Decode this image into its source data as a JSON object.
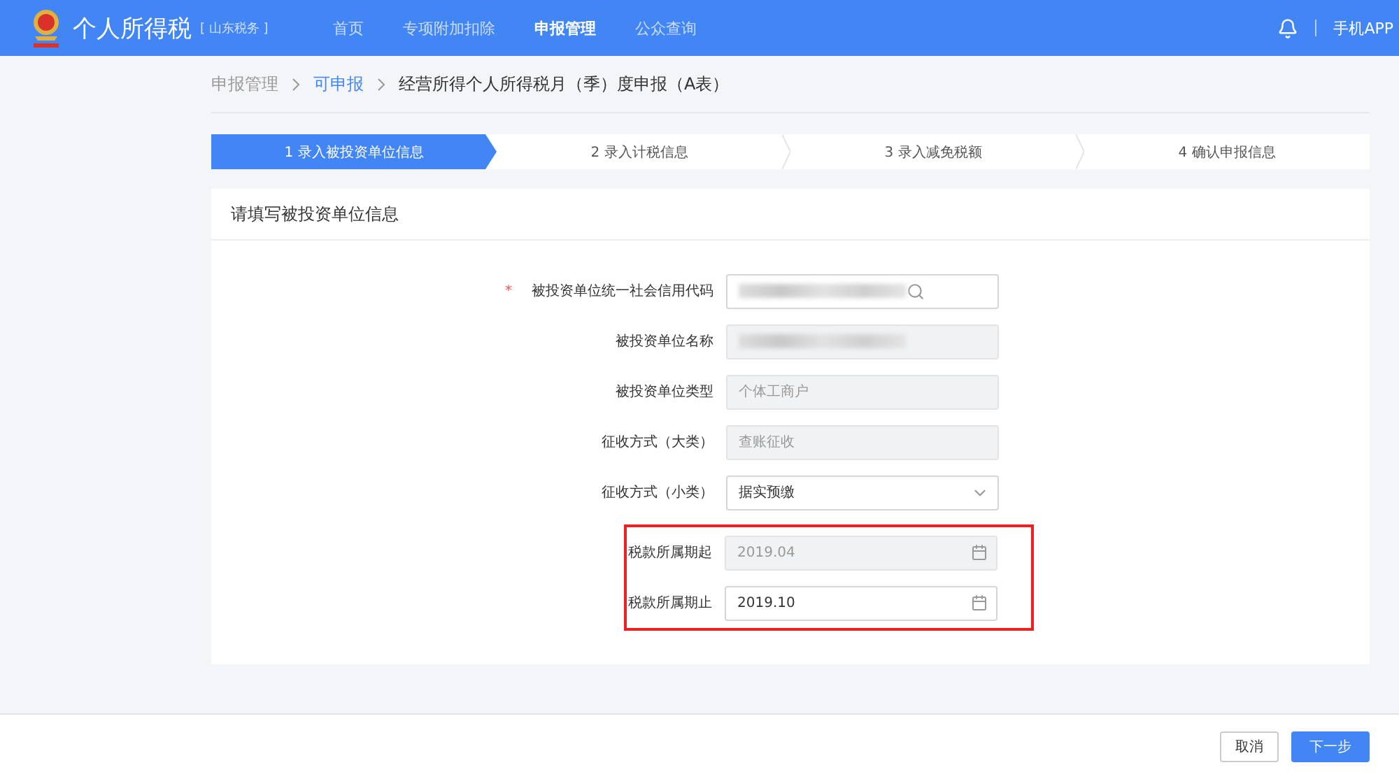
{
  "header": {
    "title": "个人所得税",
    "region": "[ 山东税务 ]",
    "nav": [
      {
        "label": "首页",
        "selected": false
      },
      {
        "label": "专项附加扣除",
        "selected": false
      },
      {
        "label": "申报管理",
        "selected": true
      },
      {
        "label": "公众查询",
        "selected": false
      }
    ],
    "app_link": "手机APP"
  },
  "breadcrumb": [
    {
      "label": "申报管理",
      "kind": "link"
    },
    {
      "label": "可申报",
      "kind": "active"
    },
    {
      "label": "经营所得个人所得税月（季）度申报（A表）",
      "kind": "current"
    }
  ],
  "steps": [
    {
      "label": "1 录入被投资单位信息",
      "selected": true
    },
    {
      "label": "2 录入计税信息",
      "selected": false
    },
    {
      "label": "3 录入减免税额",
      "selected": false
    },
    {
      "label": "4 确认申报信息",
      "selected": false
    }
  ],
  "form": {
    "title": "请填写被投资单位信息",
    "fields": [
      {
        "label": "被投资单位统一社会信用代码",
        "marker": "*",
        "kind": "search",
        "redacted": true,
        "disabled": false,
        "highlighted": false
      },
      {
        "label": "被投资单位名称",
        "kind": "text",
        "redacted": true,
        "disabled": true,
        "highlighted": false
      },
      {
        "label": "被投资单位类型",
        "kind": "text",
        "value": "个体工商户",
        "disabled": true,
        "highlighted": false
      },
      {
        "label": "征收方式（大类）",
        "kind": "text",
        "value": "查账征收",
        "disabled": true,
        "highlighted": false
      },
      {
        "label": "征收方式（小类）",
        "kind": "select",
        "value": "据实预缴",
        "disabled": false,
        "highlighted": false
      },
      {
        "label": "税款所属期起",
        "kind": "date",
        "value": "2019.04",
        "disabled": true,
        "highlighted": true
      },
      {
        "label": "税款所属期止",
        "kind": "date",
        "value": "2019.10",
        "disabled": false,
        "highlighted": true
      }
    ]
  },
  "buttons": [
    {
      "label": "取消",
      "kind": "secondary"
    },
    {
      "label": "下一步",
      "kind": "primary"
    }
  ]
}
